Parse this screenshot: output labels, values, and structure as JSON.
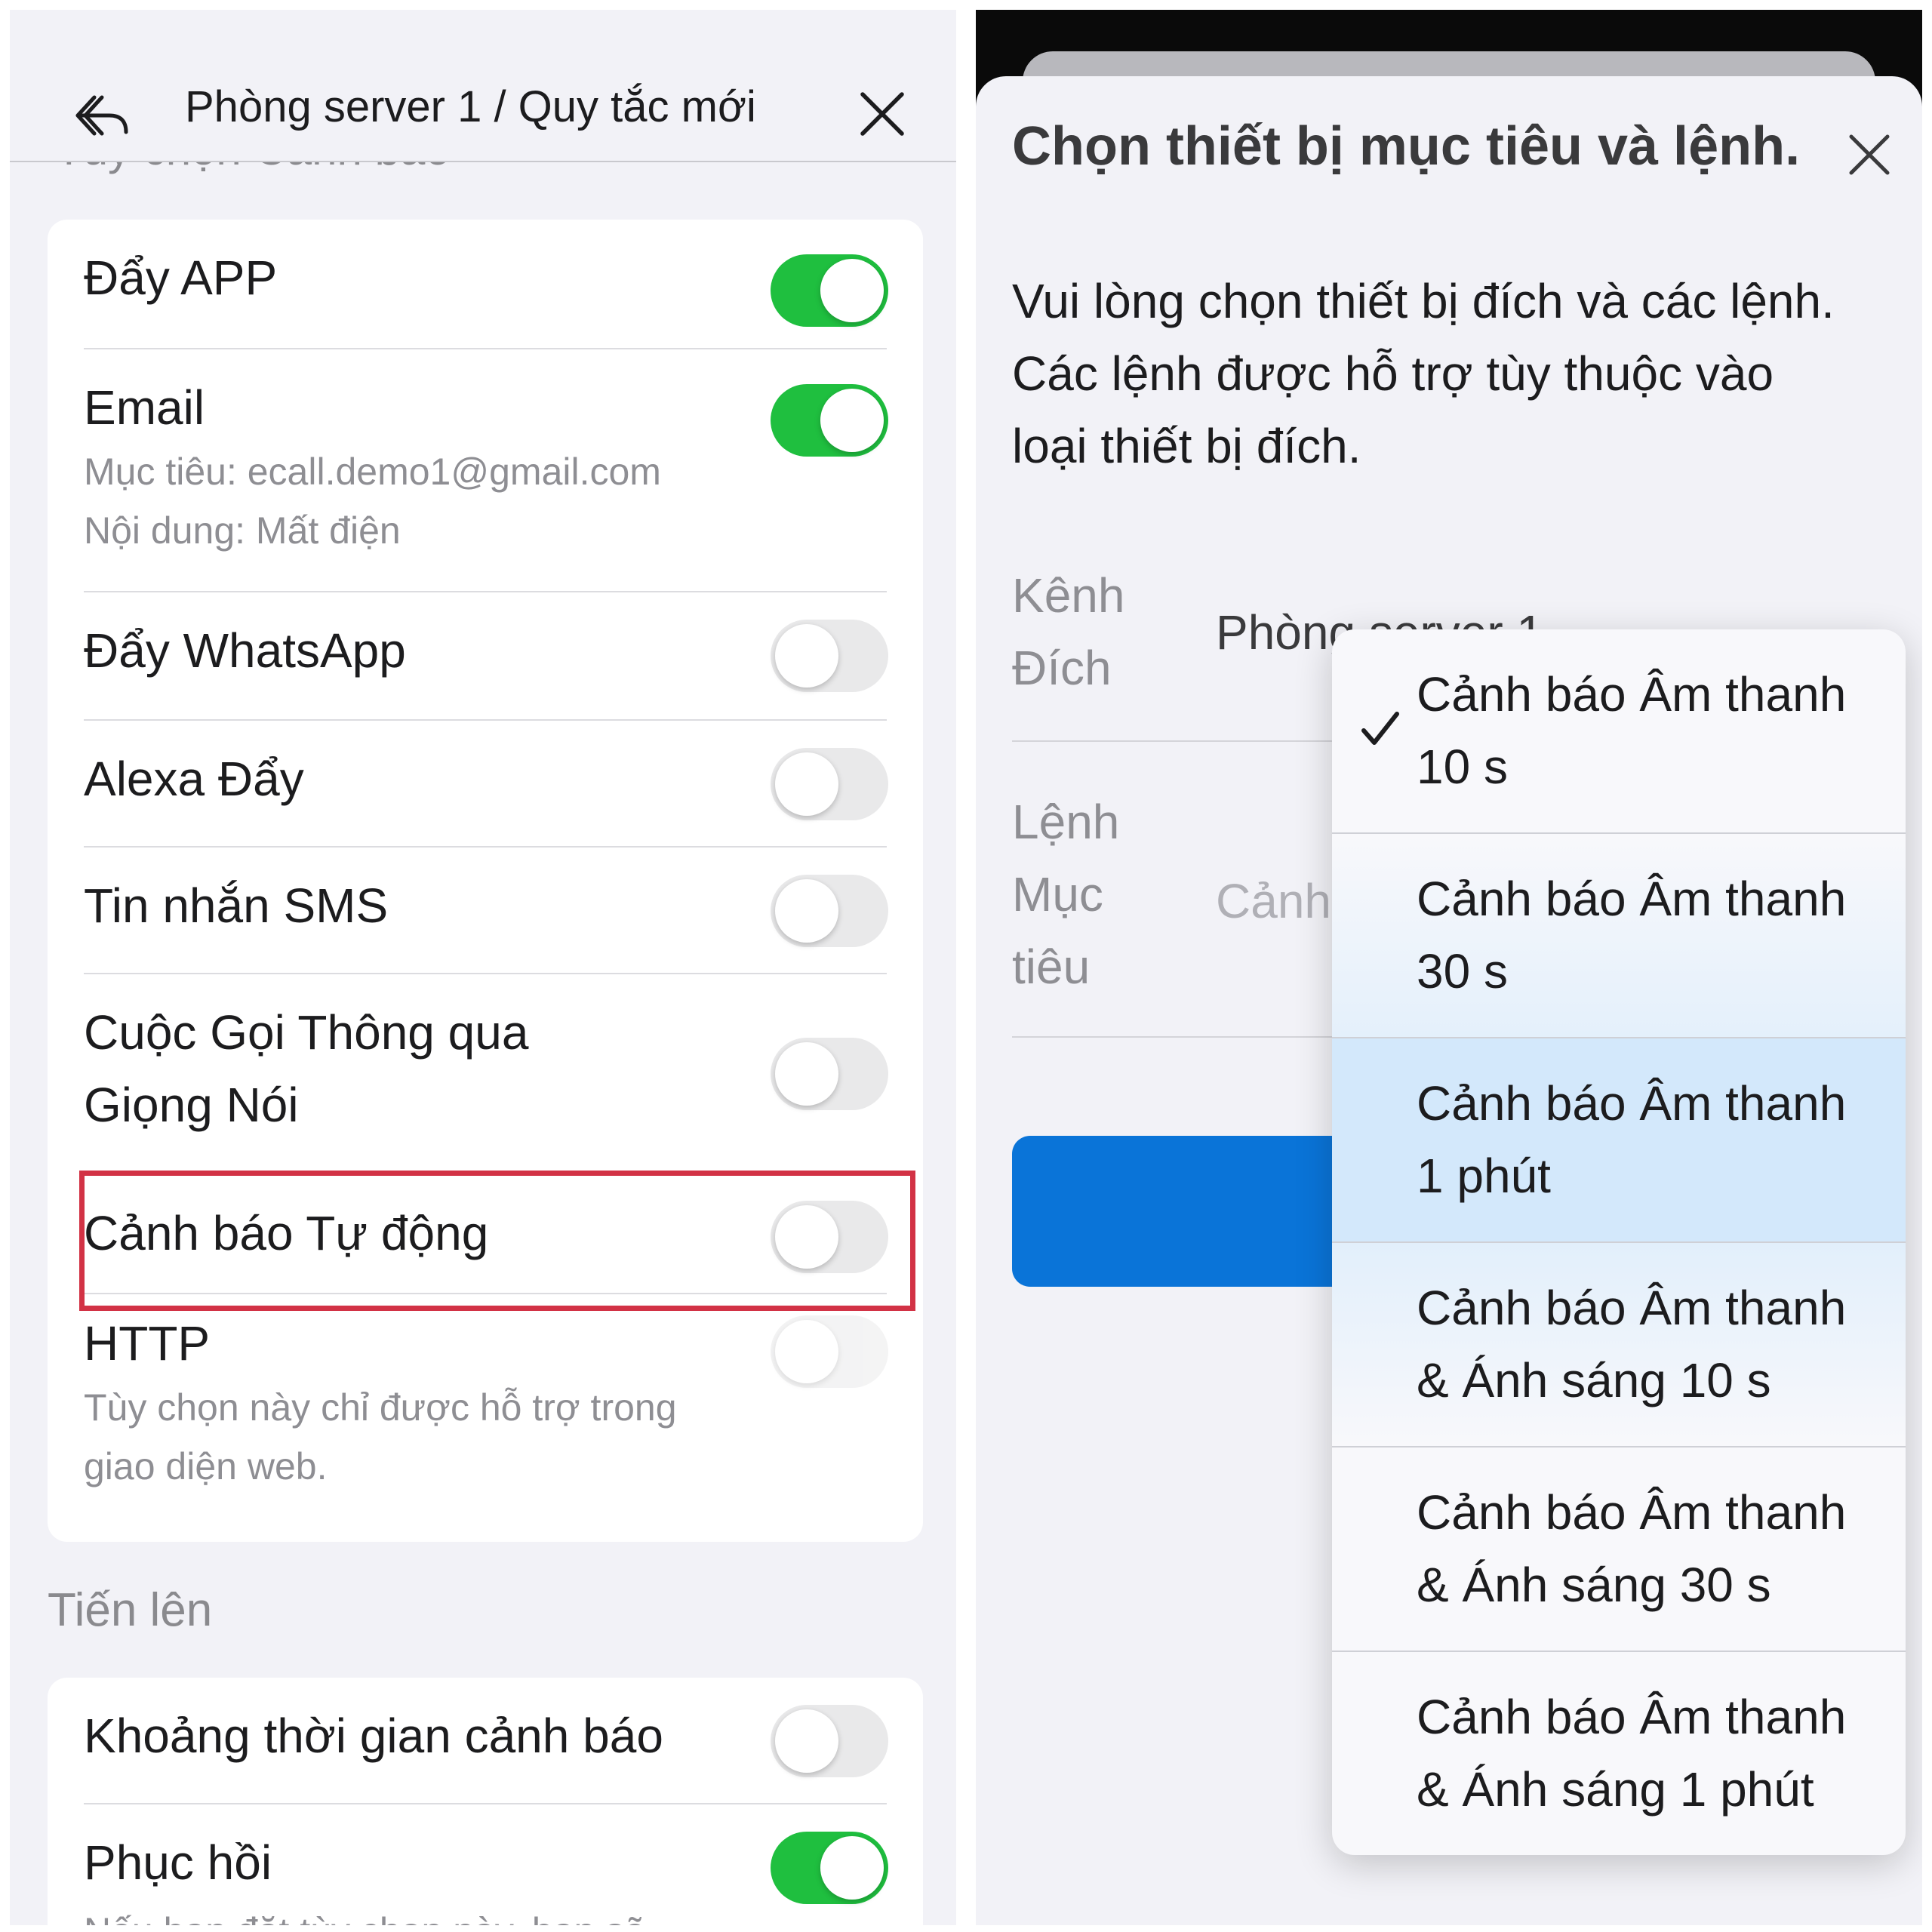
{
  "left": {
    "header": {
      "title": "Phòng server 1 / Quy tắc mới"
    },
    "section_peek": "Tùy chọn Cảnh báo",
    "notifications": [
      {
        "label": "Đẩy APP",
        "on": true
      },
      {
        "label": "Email",
        "on": true,
        "target": "Mục tiêu: ecall.demo1@gmail.com",
        "content": "Nội dung: Mất điện"
      },
      {
        "label": "Đẩy WhatsApp",
        "on": false
      },
      {
        "label": "Alexa Đẩy",
        "on": false
      },
      {
        "label": "Tin nhắn SMS",
        "on": false
      },
      {
        "label_line1": "Cuộc Gọi Thông qua",
        "label_line2": "Giọng Nói",
        "on": false
      },
      {
        "label": "Cảnh báo Tự động",
        "on": false,
        "highlighted": true
      },
      {
        "label": "HTTP",
        "on": false,
        "disabled": true,
        "note_line1": "Tùy chọn này chỉ được hỗ trợ trong",
        "note_line2": "giao diện web."
      }
    ],
    "section_advanced": "Tiến lên",
    "advanced": [
      {
        "label": "Khoảng thời gian cảnh báo",
        "on": false
      },
      {
        "label": "Phục hồi",
        "on": true,
        "note": "Nếu bạn đặt tùy chọn này, bạn sẽ"
      }
    ]
  },
  "right": {
    "sheet_title": "Chọn thiết bị mục tiêu và lệnh.",
    "instructions": [
      "Vui lòng chọn thiết bị đích và các lệnh.",
      "Các lệnh được hỗ trợ tùy thuộc vào",
      "loại thiết bị đích."
    ],
    "fields": {
      "target_channel_label": [
        "Kênh",
        "Đích"
      ],
      "target_channel_value": "Phòng server 1",
      "target_command_label": [
        "Lệnh",
        "Mục",
        "tiêu"
      ],
      "target_command_value": "Cảnh"
    },
    "dropdown_options": [
      {
        "line1": "Cảnh báo Âm thanh",
        "line2": "10 s",
        "selected": true
      },
      {
        "line1": "Cảnh báo Âm thanh",
        "line2": "30 s",
        "selected": false
      },
      {
        "line1": "Cảnh báo Âm thanh",
        "line2": "1 phút",
        "selected": false
      },
      {
        "line1": "Cảnh báo Âm thanh",
        "line2": "& Ánh sáng 10 s",
        "selected": false
      },
      {
        "line1": "Cảnh báo Âm thanh",
        "line2": "& Ánh sáng 30 s",
        "selected": false
      },
      {
        "line1": "Cảnh báo Âm thanh",
        "line2": "& Ánh sáng 1 phút",
        "selected": false
      }
    ]
  },
  "colors": {
    "toggle_on": "#1fbf3f",
    "toggle_off": "#e9e9ea",
    "highlight_border": "#d23245",
    "primary_button": "#0a74d8",
    "option_highlight": "#d3e8fb"
  }
}
